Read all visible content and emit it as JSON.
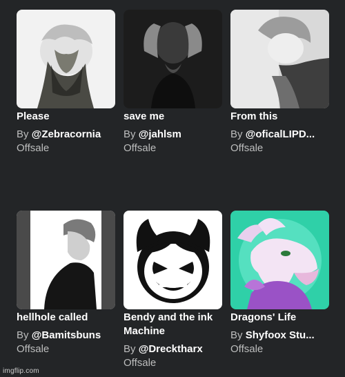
{
  "items": [
    {
      "name": "Please",
      "by_prefix": "By",
      "creator": "@Zebracornia",
      "price": "Offsale",
      "thumb_icon": "anime-boy-holding-face-image"
    },
    {
      "name": "save me",
      "by_prefix": "By",
      "creator": "@jahlsm",
      "price": "Offsale",
      "thumb_icon": "person-hands-on-head-image"
    },
    {
      "name": "From this",
      "by_prefix": "By",
      "creator": "@oficalLIPD...",
      "price": "Offsale",
      "thumb_icon": "sad-anime-boy-image"
    },
    {
      "name": "hellhole called",
      "by_prefix": "By",
      "creator": "@Bamitsbuns",
      "price": "Offsale",
      "thumb_icon": "anime-boy-profile-image"
    },
    {
      "name": "Bendy and the ink Machine",
      "by_prefix": "By",
      "creator": "@Drecktharx",
      "price": "Offsale",
      "thumb_icon": "bendy-face-image"
    },
    {
      "name": "Dragons' Life",
      "by_prefix": "By",
      "creator": "Shyfoox Stu...",
      "price": "Offsale",
      "thumb_icon": "pink-dragon-image"
    }
  ],
  "colors": {
    "background": "#232527",
    "text_primary": "#ffffff",
    "text_secondary": "#bdbebe"
  },
  "watermark": "imgflip.com"
}
